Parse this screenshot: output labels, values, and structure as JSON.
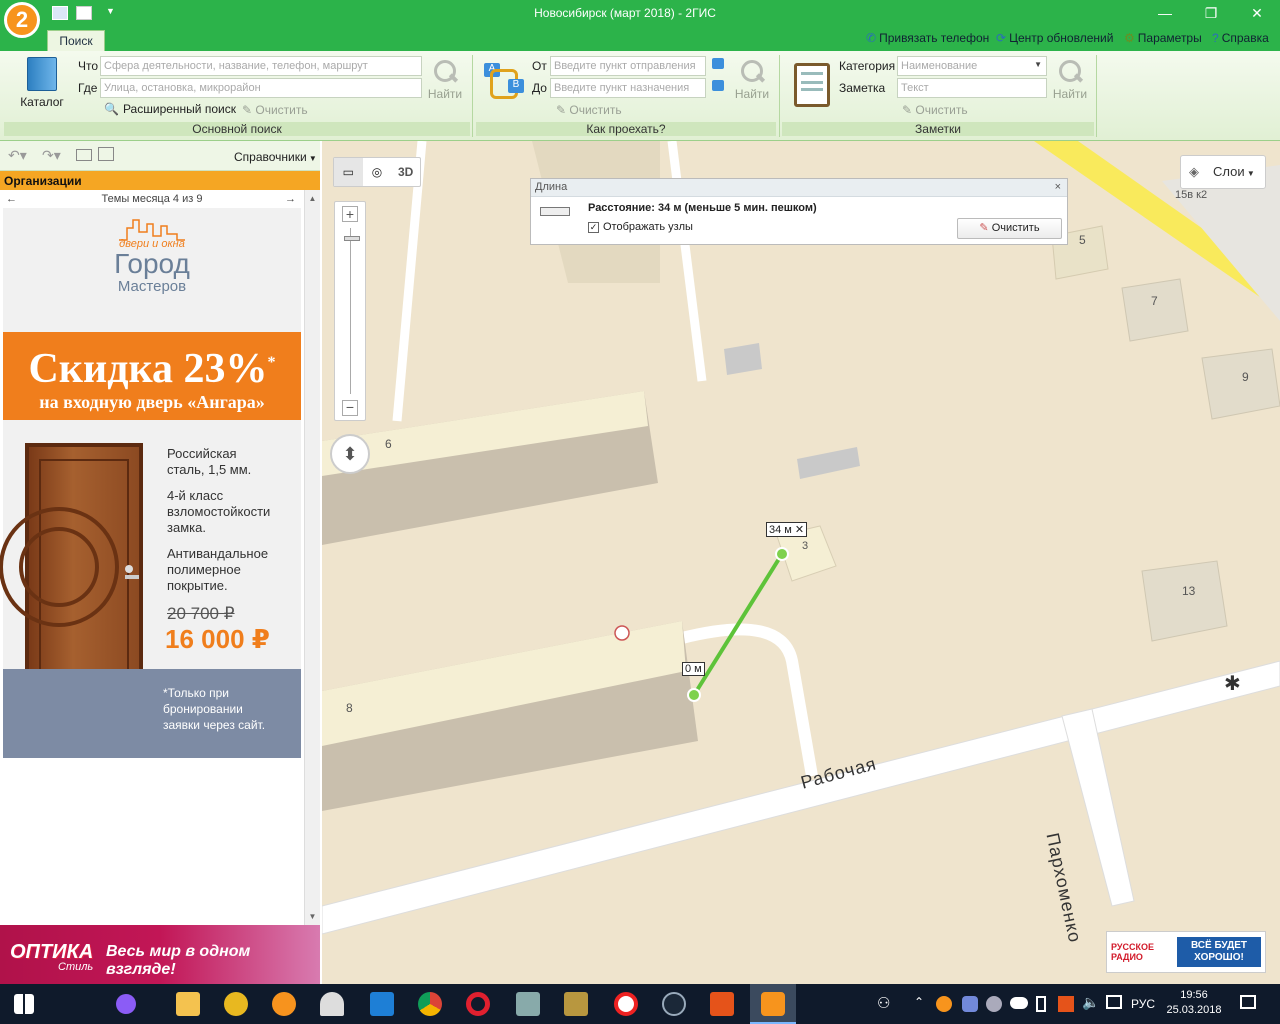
{
  "window": {
    "title": "Новосибирск (март 2018) - 2ГИС"
  },
  "ribbon": {
    "tab": "Поиск",
    "top_links": [
      {
        "label": "Привязать телефон",
        "icon": "phone-icon"
      },
      {
        "label": "Центр обновлений",
        "icon": "refresh-icon"
      },
      {
        "label": "Параметры",
        "icon": "gear-icon"
      },
      {
        "label": "Справка",
        "icon": "help-icon"
      }
    ],
    "main_search": {
      "catalog_label": "Каталог",
      "what_label": "Что",
      "what_placeholder": "Сфера деятельности, название, телефон, маршрут",
      "where_label": "Где",
      "where_placeholder": "Улица, остановка, микрорайон",
      "find_label": "Найти",
      "advanced_label": "Расширенный поиск",
      "clear_label": "Очистить",
      "group_label": "Основной поиск"
    },
    "route": {
      "from_label": "От",
      "from_placeholder": "Введите пункт отправления",
      "to_label": "До",
      "to_placeholder": "Введите пункт назначения",
      "find_label": "Найти",
      "clear_label": "Очистить",
      "group_label": "Как проехать?"
    },
    "notes": {
      "category_label": "Категория",
      "category_placeholder": "Наименование",
      "note_label": "Заметка",
      "note_placeholder": "Текст",
      "find_label": "Найти",
      "clear_label": "Очистить",
      "group_label": "Заметки"
    }
  },
  "left_panel": {
    "directory_label": "Справочники",
    "org_header": "Организации",
    "themes_label": "Темы месяца 4 из 9",
    "ad": {
      "logo_line1": "двери и окна",
      "logo_line2": "Город",
      "logo_line3": "Мастеров",
      "discount": "Скидка 23%",
      "discount_star": "*",
      "discount_sub": "на входную дверь «Ангара»",
      "feature1": "Российская сталь, 1,5 мм.",
      "feature2": "4-й класс взломостойкости замка.",
      "feature3": "Антивандальное полимерное покрытие.",
      "old_price": "20 700 ₽",
      "new_price": "16 000 ₽",
      "footnote": "*Только при бронировании заявки через сайт."
    },
    "bottom_ad": {
      "brand": "ОПТИКА",
      "brand_sub": "Стиль",
      "slogan": "Весь мир в одном взгляде!"
    }
  },
  "map": {
    "distance_panel": {
      "title": "Длина",
      "distance_text": "Расстояние: 34 м (меньше 5 мин. пешком)",
      "show_nodes_label": "Отображать узлы",
      "show_nodes_checked": true,
      "clear_label": "Очистить"
    },
    "layers_label": "Слои",
    "mode_3d": "3D",
    "measure_start": "0 м",
    "measure_end": "34 м",
    "building_numbers": [
      "6",
      "8",
      "3",
      "5",
      "7",
      "9",
      "13",
      "15в к2"
    ],
    "streets": [
      "Рабочая",
      "Пархоменко"
    ],
    "radio_ad": {
      "brand": "РУССКОЕ РАДИО",
      "slogan": "ВСЁ БУДЕТ ХОРОШО!"
    }
  },
  "taskbar": {
    "lang": "РУС",
    "time": "19:56",
    "date": "25.03.2018"
  }
}
